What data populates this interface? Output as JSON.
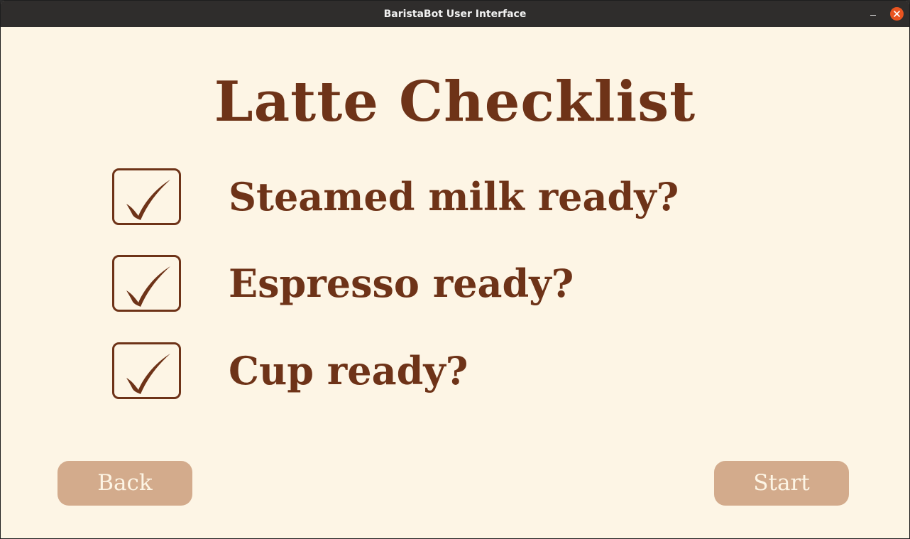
{
  "window": {
    "title": "BaristaBot User Interface",
    "minimize_icon": "minimize-icon",
    "close_icon": "close-icon"
  },
  "heading": "Latte Checklist",
  "checklist": [
    {
      "label": "Steamed milk ready?",
      "checked": true
    },
    {
      "label": "Espresso ready?",
      "checked": true
    },
    {
      "label": "Cup ready?",
      "checked": true
    }
  ],
  "buttons": {
    "back": "Back",
    "start": "Start"
  },
  "colors": {
    "background": "#fdf5e5",
    "text": "#6e3318",
    "button": "#d3ab8c",
    "button_text": "#fdf5e5",
    "titlebar": "#2f2d2c",
    "close": "#e95420"
  }
}
